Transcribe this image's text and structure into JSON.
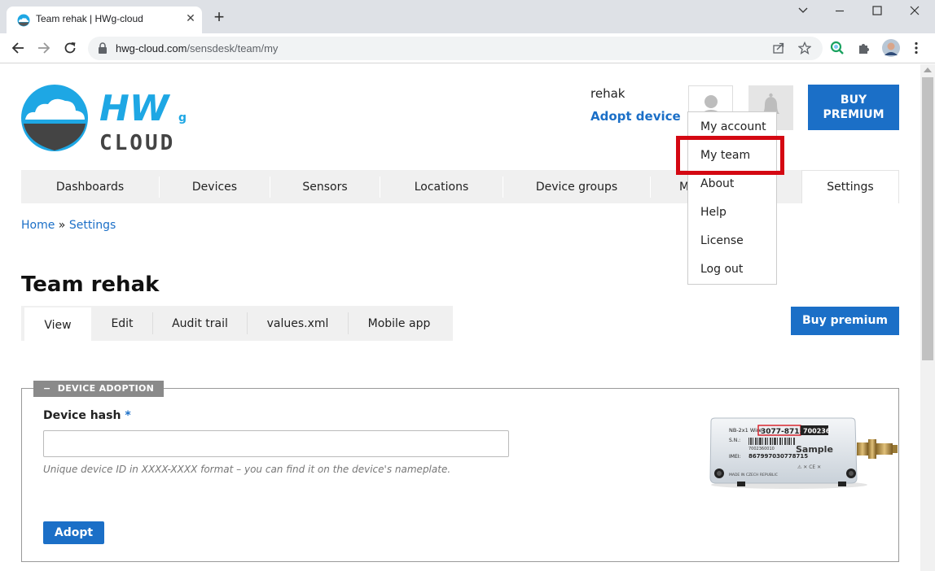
{
  "browser": {
    "tab_title": "Team rehak | HWg-cloud",
    "url_host": "hwg-cloud.com",
    "url_path": "/sensdesk/team/my"
  },
  "header": {
    "username": "rehak",
    "adopt_link": "Adopt device",
    "buy_premium": "BUY PREMIUM"
  },
  "logo": {
    "text_top": "HW",
    "text_sub": "g",
    "text_bottom": "CLOUD",
    "color": "#1ea7e4"
  },
  "user_menu": {
    "items": [
      "My account",
      "My team",
      "About",
      "Help",
      "License",
      "Log out"
    ],
    "highlighted": "My team"
  },
  "main_nav": {
    "items": [
      "Dashboards",
      "Devices",
      "Sensors",
      "Locations",
      "Device groups",
      "M",
      "Settings"
    ],
    "active": "Settings"
  },
  "breadcrumb": {
    "home": "Home",
    "separator": "»",
    "current": "Settings"
  },
  "page_title": "Team rehak",
  "sub_tabs": {
    "items": [
      "View",
      "Edit",
      "Audit trail",
      "values.xml",
      "Mobile app"
    ],
    "active": "View"
  },
  "buy_premium_small": "Buy premium",
  "device_adoption": {
    "legend": "DEVICE ADOPTION",
    "legend_toggle": "−",
    "field_label": "Device hash",
    "required_mark": "*",
    "input_value": "",
    "help_text": "Unique device ID in XXXX-XXXX format – you can find it on the device's nameplate.",
    "submit": "Adopt",
    "device_label": {
      "model": "NB-2x1 Wire",
      "hash": "3077-8715",
      "id": "700236",
      "sn_label": "S.N.:",
      "sn_value": "7002360010",
      "imei_label": "IMEI:",
      "imei_value": "867997030778715",
      "sample": "Sample",
      "footer": "MADE IN CZECH REPUBLIC"
    }
  },
  "colors": {
    "accent": "#1b6fc7",
    "highlight": "#d40812"
  }
}
